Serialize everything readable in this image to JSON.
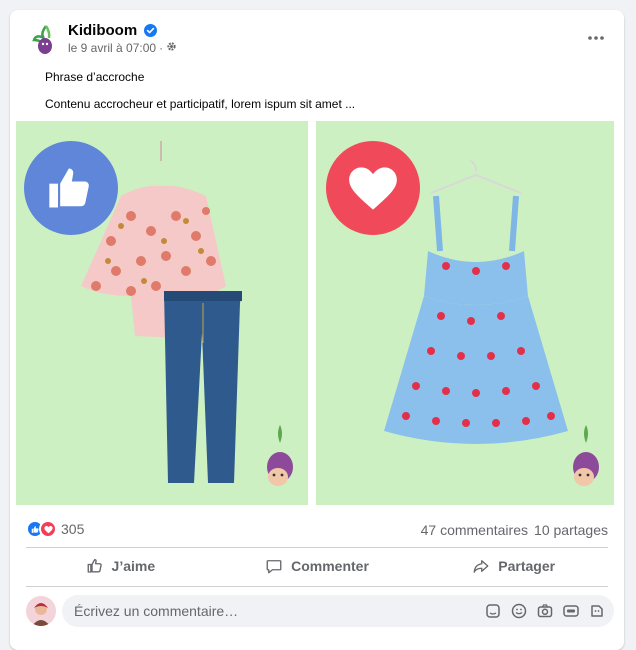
{
  "post": {
    "page_name": "Kidiboom",
    "verified": true,
    "timestamp": "le 9 avril à 07:00",
    "separator": "·",
    "privacy_icon": "settings-gear-icon",
    "headline": "Phrase d’accroche",
    "body": "Contenu accrocheur et participatif, lorem ispum sit amet ..."
  },
  "media": {
    "left_panel": {
      "reaction": "like",
      "bg": "#cdf0c3"
    },
    "right_panel": {
      "reaction": "love",
      "bg": "#cdf0c3"
    }
  },
  "stats": {
    "reaction_count": "305",
    "comments": "47 commentaires",
    "shares": "10 partages"
  },
  "actions": {
    "like": "J’aime",
    "comment": "Commenter",
    "share": "Partager"
  },
  "composer": {
    "placeholder": "Écrivez un commentaire…",
    "tools": [
      "sticker-icon",
      "emoji-icon",
      "camera-icon",
      "gif-icon",
      "avatar-sticker-icon"
    ]
  },
  "colors": {
    "like_blue": "#1877f2",
    "love_red": "#f33e58",
    "like_big": "#5f86d8",
    "love_big": "#f0495a",
    "verified_blue": "#1877f2"
  }
}
